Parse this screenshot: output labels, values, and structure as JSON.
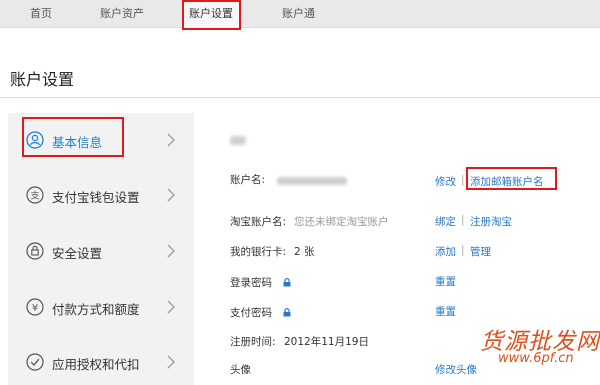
{
  "nav": {
    "tabs": [
      {
        "label": "首页"
      },
      {
        "label": "账户资产"
      },
      {
        "label": "账户设置",
        "active": true
      },
      {
        "label": "账户通"
      }
    ]
  },
  "page": {
    "title": "账户设置"
  },
  "sidebar": {
    "items": [
      {
        "label": "基本信息",
        "icon": "user-icon",
        "active": true
      },
      {
        "label": "支付宝钱包设置",
        "icon": "wallet-icon"
      },
      {
        "label": "安全设置",
        "icon": "lock-icon"
      },
      {
        "label": "付款方式和额度",
        "icon": "yuan-icon"
      },
      {
        "label": "应用授权和代扣",
        "icon": "check-icon"
      }
    ]
  },
  "main": {
    "account_name": {
      "label": "账户名:",
      "edit": "修改",
      "sep": "|",
      "add_email": "添加邮箱账户名"
    },
    "taobao": {
      "label": "淘宝账户名:",
      "value": "您还未绑定淘宝账户",
      "bind": "绑定",
      "sep": "|",
      "register": "注册淘宝"
    },
    "bank": {
      "label": "我的银行卡:",
      "value": "2 张",
      "add": "添加",
      "sep": "|",
      "manage": "管理"
    },
    "login_pwd": {
      "label": "登录密码",
      "reset": "重置"
    },
    "pay_pwd": {
      "label": "支付密码",
      "reset": "重置"
    },
    "register_time": {
      "label": "注册时间:",
      "value": "2012年11月19日"
    },
    "avatar": {
      "label": "头像",
      "edit": "修改头像"
    }
  },
  "watermark": {
    "line1": "货源批发网",
    "line2": "www.6pf.cn"
  },
  "colors": {
    "link": "#2a78c8",
    "highlight": "#e0191a",
    "active": "#1c7fd6",
    "watermark": "#e04f1a"
  }
}
